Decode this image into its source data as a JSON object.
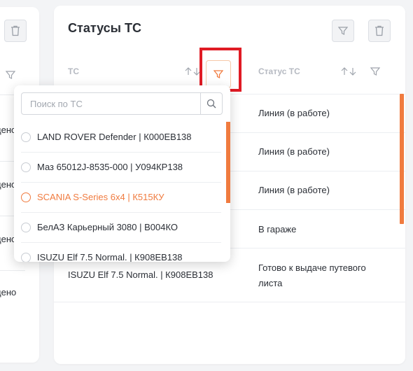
{
  "left_panel": {
    "rows": [
      "дено",
      "дено",
      "дено",
      "дено"
    ]
  },
  "card": {
    "title": "Статусы ТС",
    "columns": {
      "vehicle": "ТС",
      "status": "Статус ТС"
    },
    "rows": [
      {
        "vehicle": "",
        "status": "Линия (в работе)"
      },
      {
        "vehicle": "",
        "status": "Линия (в работе)"
      },
      {
        "vehicle": "",
        "status": "Линия (в работе)"
      },
      {
        "vehicle": "",
        "status": "В гараже"
      },
      {
        "vehicle": "ISUZU Elf 7.5 Normal. | К908ЕВ138",
        "status": "Готово к выдаче путевого листа"
      }
    ]
  },
  "filter_dropdown": {
    "search_placeholder": "Поиск по ТС",
    "options": [
      {
        "label": "LAND ROVER Defender | К000ЕВ138",
        "selected": false
      },
      {
        "label": "Маз 65012J-8535-000 | У094КР138",
        "selected": false
      },
      {
        "label": "SCANIA S-Series 6x4 | К515КУ",
        "selected": true
      },
      {
        "label": "БелАЗ Карьерный 3080 | В004КО",
        "selected": false
      },
      {
        "label": "ISUZU Elf 7.5 Normal. | К908ЕВ138",
        "selected": false
      }
    ]
  },
  "colors": {
    "accent": "#f07b3f",
    "highlight": "#e01b24",
    "muted": "#b6bac2"
  }
}
